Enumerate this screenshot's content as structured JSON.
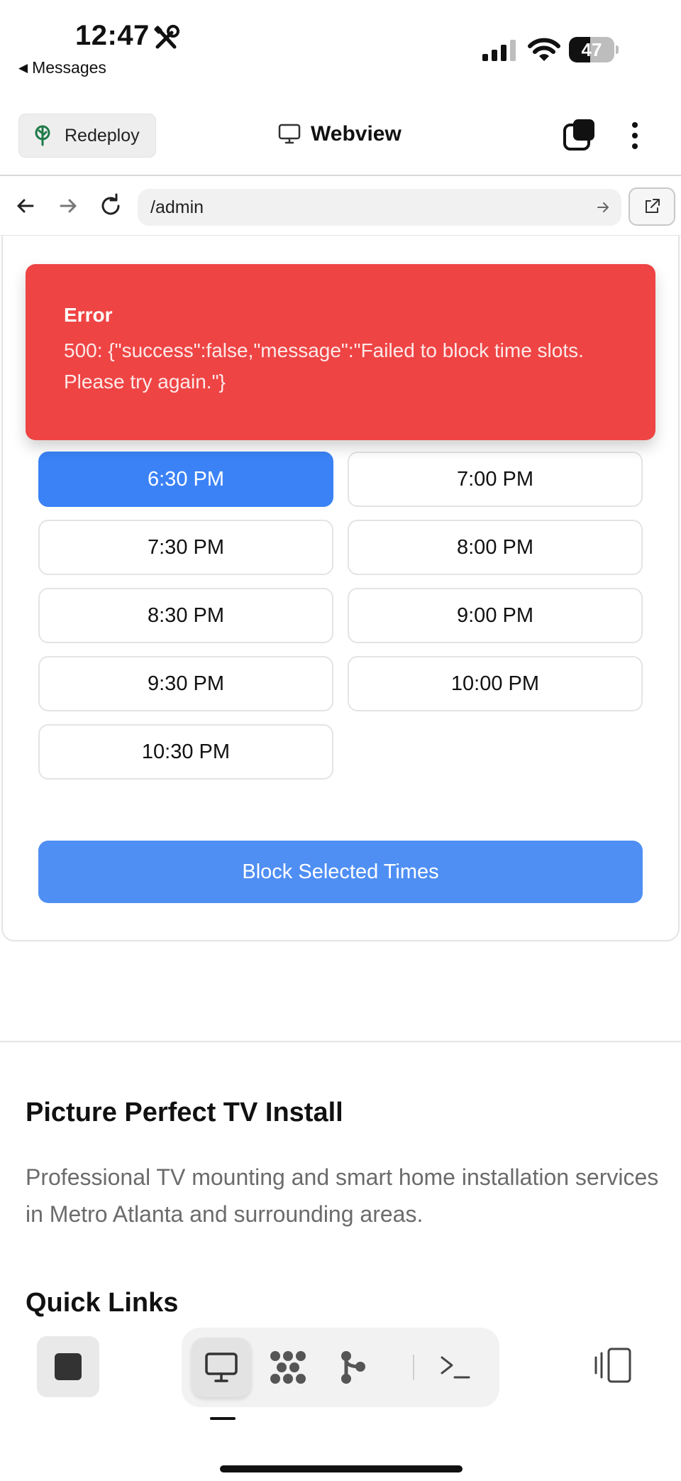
{
  "status_bar": {
    "time": "12:47",
    "back_app_label": "Messages",
    "battery_level": "47",
    "battery_fraction": 0.47
  },
  "toolbar": {
    "redeploy_label": "Redeploy",
    "title": "Webview"
  },
  "url_bar": {
    "url": "/admin"
  },
  "error": {
    "title": "Error",
    "message": "500: {\"success\":false,\"message\":\"Failed to block time slots. Please try again.\"}"
  },
  "time_slots": [
    {
      "label": "6:30 PM",
      "selected": true
    },
    {
      "label": "7:00 PM",
      "selected": false
    },
    {
      "label": "7:30 PM",
      "selected": false
    },
    {
      "label": "8:00 PM",
      "selected": false
    },
    {
      "label": "8:30 PM",
      "selected": false
    },
    {
      "label": "9:00 PM",
      "selected": false
    },
    {
      "label": "9:30 PM",
      "selected": false
    },
    {
      "label": "10:00 PM",
      "selected": false
    },
    {
      "label": "10:30 PM",
      "selected": false
    }
  ],
  "block_button_label": "Block Selected Times",
  "footer": {
    "title": "Picture Perfect TV Install",
    "description": "Professional TV mounting and smart home installation services in Metro Atlanta and surrounding areas.",
    "quick_links_heading": "Quick Links"
  },
  "colors": {
    "error_bg": "#ef4444",
    "selected_slot": "#3b82f6",
    "primary_button": "#4f8ff4"
  },
  "icons": {
    "status": [
      "tools-icon",
      "signal-icon",
      "wifi-icon",
      "battery-icon"
    ],
    "toolbar": [
      "tree-icon",
      "monitor-icon",
      "tabs-icon",
      "more-vertical-icon"
    ],
    "url_bar": [
      "arrow-left-icon",
      "arrow-right-icon",
      "reload-icon",
      "arrow-right-small-icon",
      "external-link-icon"
    ],
    "dock": [
      "stop-icon",
      "monitor-icon",
      "dots-grid-icon",
      "git-branch-icon",
      "terminal-icon",
      "layout-panels-icon"
    ]
  }
}
